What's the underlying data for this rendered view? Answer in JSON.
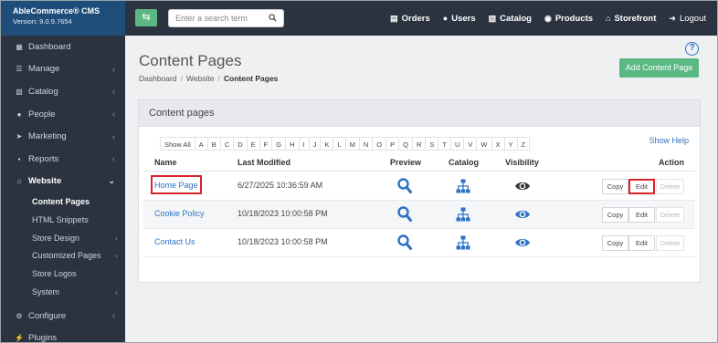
{
  "brand": {
    "title": "AbleCommerce® CMS",
    "version": "Version: 9.0.9.7654"
  },
  "sidebar": {
    "items": [
      {
        "label": "Dashboard",
        "icon": "th-large-icon"
      },
      {
        "label": "Manage",
        "icon": "list-icon"
      },
      {
        "label": "Catalog",
        "icon": "sitemap-icon"
      },
      {
        "label": "People",
        "icon": "users-icon"
      },
      {
        "label": "Marketing",
        "icon": "paper-plane-icon"
      },
      {
        "label": "Reports",
        "icon": "bar-chart-icon"
      },
      {
        "label": "Website",
        "icon": "home-icon"
      }
    ],
    "website_sub": [
      {
        "label": "Content Pages"
      },
      {
        "label": "HTML Snippets"
      },
      {
        "label": "Store Design"
      },
      {
        "label": "Customized Pages"
      },
      {
        "label": "Store Logos"
      },
      {
        "label": "System"
      }
    ],
    "bottom_items": [
      {
        "label": "Configure",
        "icon": "cogs-icon"
      },
      {
        "label": "Plugins",
        "icon": "plug-icon"
      }
    ]
  },
  "topbar": {
    "search_placeholder": "Enter a search term",
    "links": [
      {
        "label": "Orders",
        "icon": "inbox-icon"
      },
      {
        "label": "Users",
        "icon": "users-icon"
      },
      {
        "label": "Catalog",
        "icon": "sitemap-icon"
      },
      {
        "label": "Products",
        "icon": "product-icon"
      },
      {
        "label": "Storefront",
        "icon": "home-icon"
      },
      {
        "label": "Logout",
        "icon": "logout-icon"
      }
    ]
  },
  "page": {
    "title": "Content Pages",
    "breadcrumb": [
      "Dashboard",
      "Website",
      "Content Pages"
    ],
    "add_button": "Add Content Page",
    "help_icon": "?"
  },
  "panel": {
    "title": "Content pages",
    "show_all": "Show All",
    "letters": [
      "A",
      "B",
      "C",
      "D",
      "E",
      "F",
      "G",
      "H",
      "I",
      "J",
      "K",
      "L",
      "M",
      "N",
      "O",
      "P",
      "Q",
      "R",
      "S",
      "T",
      "U",
      "V",
      "W",
      "X",
      "Y",
      "Z"
    ],
    "show_help": "Show Help",
    "columns": {
      "name": "Name",
      "modified": "Last Modified",
      "preview": "Preview",
      "catalog": "Catalog",
      "visibility": "Visibility",
      "action": "Action"
    },
    "actions": {
      "copy": "Copy",
      "edit": "Edit",
      "delete": "Delete"
    },
    "rows": [
      {
        "name": "Home Page",
        "modified": "6/27/2025 10:36:59 AM"
      },
      {
        "name": "Cookie Policy",
        "modified": "10/18/2023 10:00:58 PM"
      },
      {
        "name": "Contact Us",
        "modified": "10/18/2023 10:00:58 PM"
      }
    ]
  },
  "colors": {
    "accent_blue": "#2c72c5",
    "green": "#5cb883",
    "sidebar": "#2b3340",
    "brand": "#1f4d7a",
    "highlight_red": "#d8232a"
  }
}
